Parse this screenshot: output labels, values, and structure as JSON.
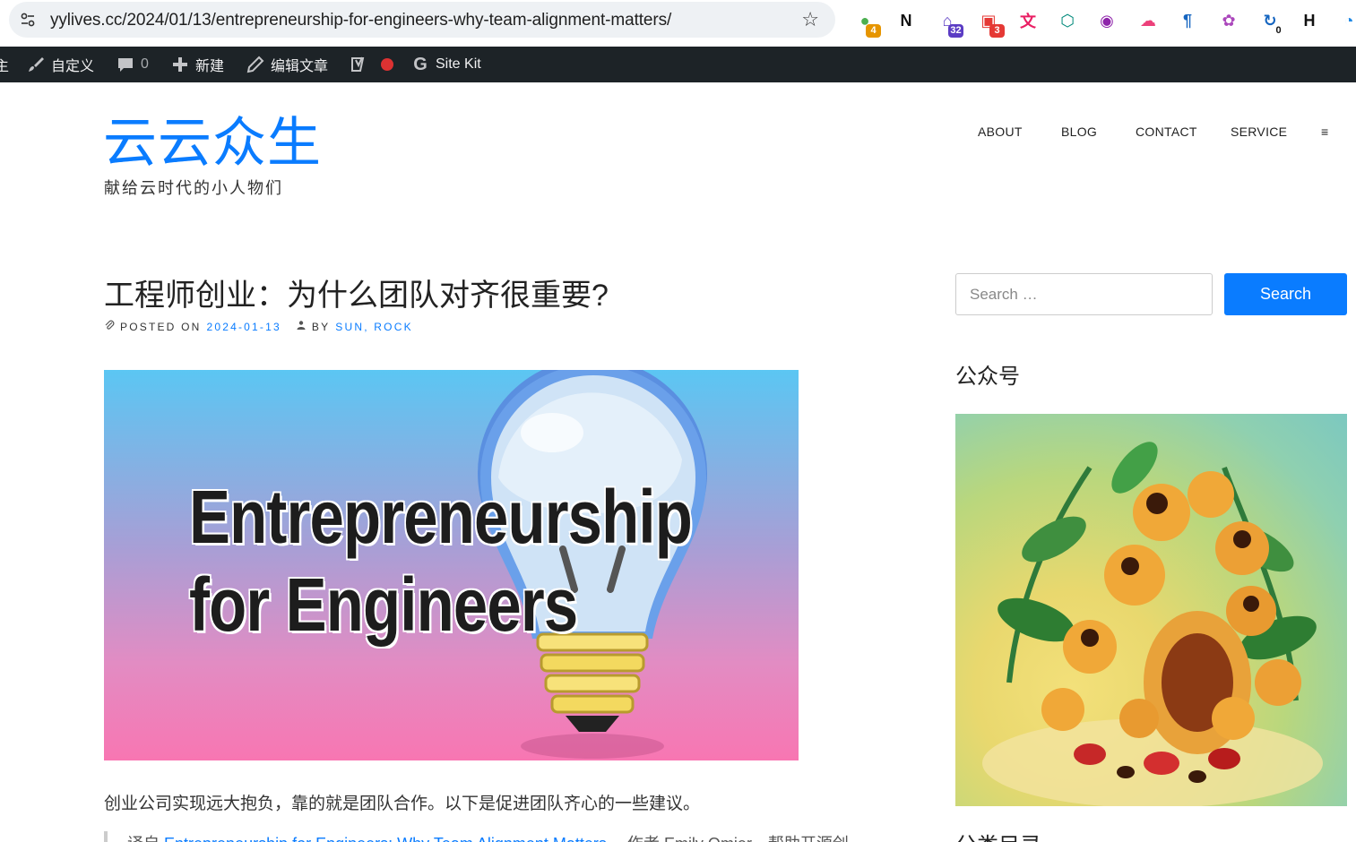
{
  "browser": {
    "url": "yylives.cc/2024/01/13/entrepreneurship-for-engineers-why-team-alignment-matters/",
    "extensions": [
      {
        "name": "chat-extension-icon",
        "badge": "4",
        "color": "#4caf50",
        "badge_color": "#e69500"
      },
      {
        "name": "notion-icon",
        "badge": "",
        "color": "#111111"
      },
      {
        "name": "graduation-cap-icon",
        "badge": "32",
        "color": "#5b3cc4",
        "badge_color": "#5b3cc4"
      },
      {
        "name": "multi-window-icon",
        "badge": "3",
        "color": "#e53935",
        "badge_color": "#e53935"
      },
      {
        "name": "translate-icon",
        "badge": "",
        "color": "#e91e63"
      },
      {
        "name": "grid-logo-icon",
        "badge": "",
        "color": "#00897b"
      },
      {
        "name": "reader-icon",
        "badge": "",
        "color": "#8e24aa"
      },
      {
        "name": "cloud-icon",
        "badge": "",
        "color": "#ec407a"
      },
      {
        "name": "paragraph-icon",
        "badge": "",
        "color": "#1565c0"
      },
      {
        "name": "openai-icon",
        "badge": "",
        "color": "#ab47bc"
      },
      {
        "name": "rotate-icon",
        "badge": "0",
        "color": "#1565c0",
        "badge_color": "#ffffff"
      },
      {
        "name": "h-logo-icon",
        "badge": "",
        "color": "#111111"
      },
      {
        "name": "blue-logo-icon",
        "badge": "",
        "color": "#1e88e5"
      }
    ]
  },
  "admin_bar": {
    "partial_label": "主",
    "customize": "自定义",
    "comments_count": "0",
    "new": "新建",
    "edit_post": "编辑文章",
    "site_kit": "Site Kit"
  },
  "site": {
    "title": "云云众生",
    "description": "献给云时代的小人物们"
  },
  "nav": {
    "items": [
      "ABOUT",
      "BLOG",
      "CONTACT",
      "SERVICE"
    ],
    "menu_glyph": "≡"
  },
  "post": {
    "title": "工程师创业：为什么团队对齐很重要?",
    "posted_on_label": "POSTED ON",
    "date": "2024-01-13",
    "by_label": "BY",
    "author": "SUN, ROCK",
    "featured_line1": "Entrepreneurship",
    "featured_line2": "for Engineers",
    "excerpt": "创业公司实现远大抱负，靠的就是团队合作。以下是促进团队齐心的一些建议。",
    "quote_prefix": "译自",
    "quote_link": "Entrepreneurship for Engineers: Why Team Alignment Matters",
    "quote_suffix": "，作者 Emily Omier。帮助开源创"
  },
  "sidebar": {
    "search_placeholder": "Search …",
    "search_button": "Search",
    "widget_title": "公众号",
    "widget2_title": "分类目录"
  }
}
